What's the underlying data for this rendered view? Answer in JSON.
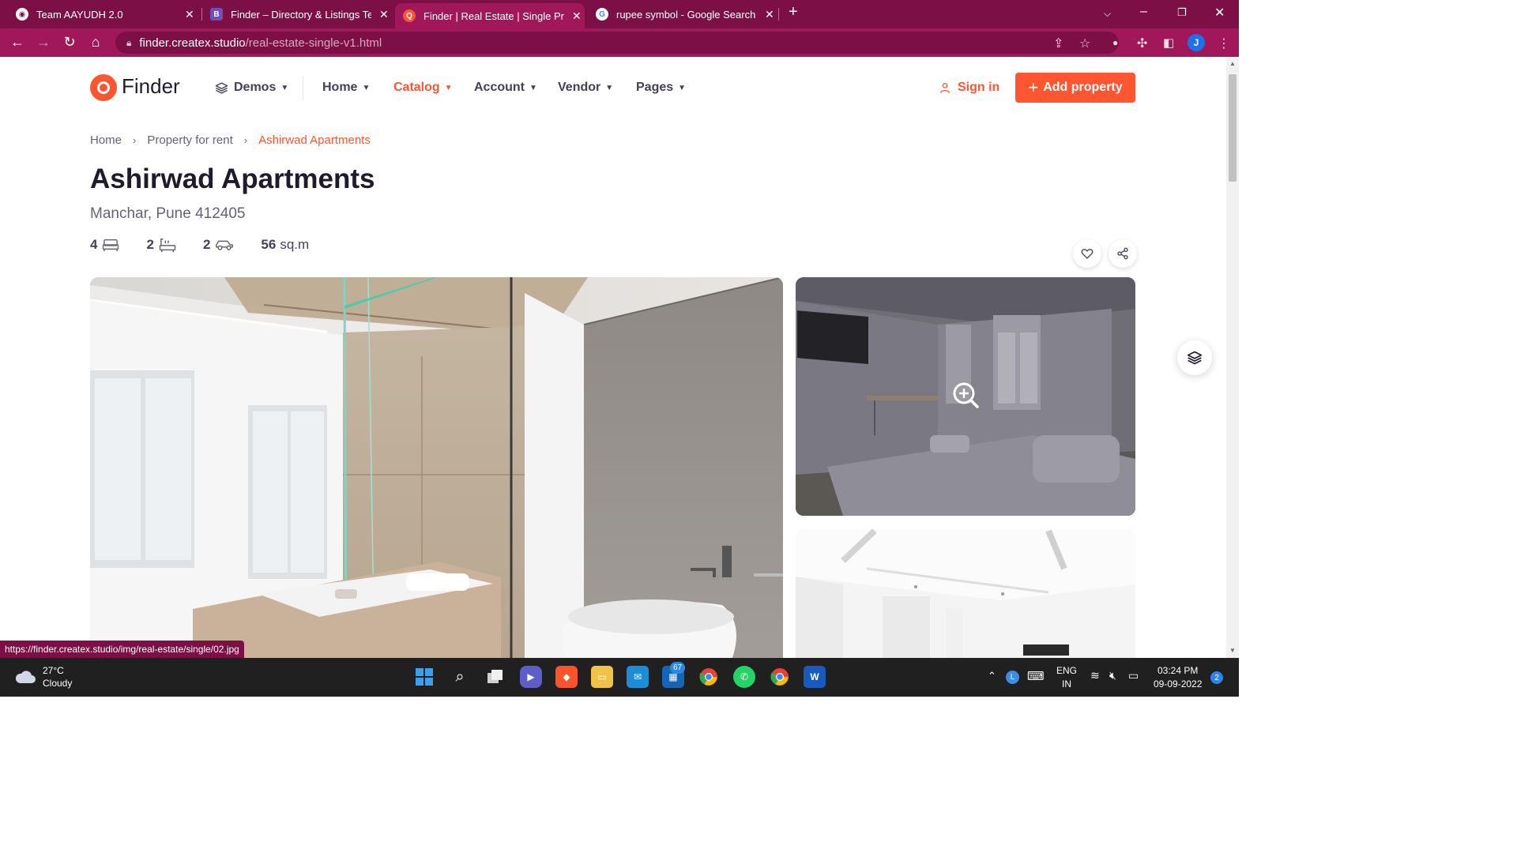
{
  "browser": {
    "tabs": [
      {
        "title": "Team AAYUDH 2.0",
        "favicon": "globe-icon"
      },
      {
        "title": "Finder – Directory & Listings Tem",
        "favicon": "bootstrap-icon"
      },
      {
        "title": "Finder | Real Estate | Single Prope",
        "favicon": "finder-icon"
      },
      {
        "title": "rupee symbol - Google Search",
        "favicon": "google-icon"
      }
    ],
    "url_host": "finder.createx.studio",
    "url_path": "/real-estate-single-v1.html",
    "profile_initial": "J",
    "status_url": "https://finder.createx.studio/img/real-estate/single/02.jpg"
  },
  "header": {
    "logo_text": "Finder",
    "nav": [
      {
        "label": "Demos"
      },
      {
        "label": "Home"
      },
      {
        "label": "Catalog"
      },
      {
        "label": "Account"
      },
      {
        "label": "Vendor"
      },
      {
        "label": "Pages"
      }
    ],
    "signin_label": "Sign in",
    "add_property_label": "Add property"
  },
  "breadcrumb": [
    "Home",
    "Property for rent",
    "Ashirwad Apartments"
  ],
  "property": {
    "title": "Ashirwad Apartments",
    "address": "Manchar, Pune 412405",
    "specs": {
      "bedrooms": "4",
      "bathrooms": "2",
      "parking": "2",
      "area_value": "56",
      "area_unit": "sq.m"
    }
  },
  "taskbar": {
    "weather_temp": "27°C",
    "weather_desc": "Cloudy",
    "mail_badge": "67",
    "lang_top": "ENG",
    "lang_bottom": "IN",
    "time": "03:24 PM",
    "date": "09-09-2022",
    "notification_count": "2"
  },
  "colors": {
    "accent": "#fd5631",
    "chrome": "#a0175a",
    "text_dark": "#1f1b2d",
    "text_muted": "#666276"
  }
}
